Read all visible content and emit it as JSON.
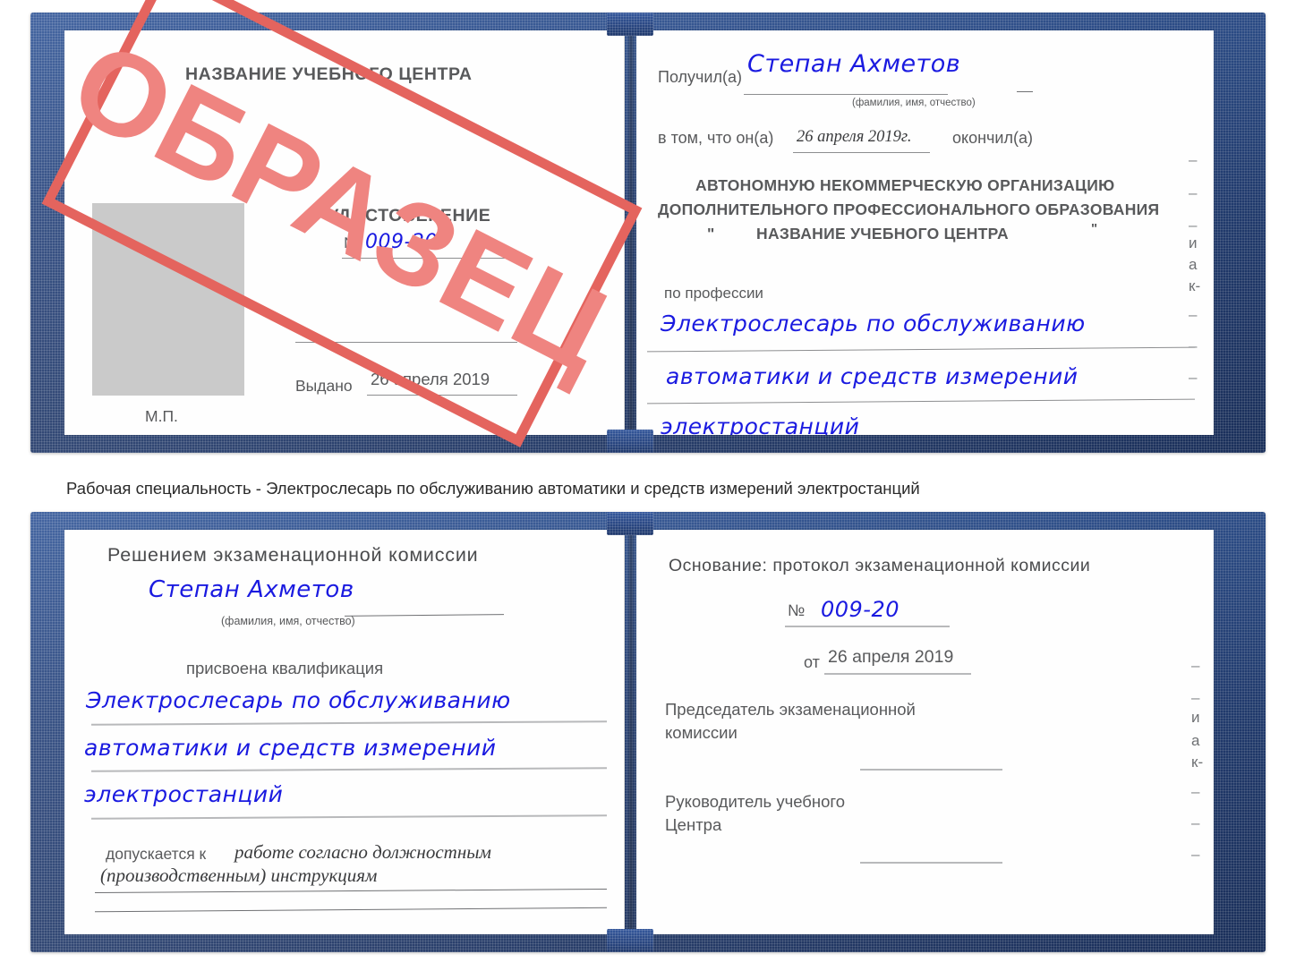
{
  "document": {
    "type": "Удостоверение (certificate booklet) — sample scan",
    "watermark": "ОБРАЗЕЦ",
    "ink_color": "#1a1ae0",
    "cover_color": "#234079",
    "stamp_color": "#e4645e"
  },
  "top_certificate": {
    "left_page": {
      "center_name": "НАЗВАНИЕ УЧЕБНОГО ЦЕНТРА",
      "title": "УДОСТОВЕРЕНИЕ",
      "number_label": "№",
      "number_value": "009-20",
      "issued_label": "Выдано",
      "issued_value": "26 апреля 2019",
      "seal_label": "М.П.",
      "photo_placeholder": "photo-area"
    },
    "right_page": {
      "received_label": "Получил(а)",
      "received_value": "Степан Ахметов",
      "received_hint": "(фамилия, имя, отчество)",
      "that_he_label": "в том, что он(а)",
      "completion_date": "26 апреля 2019г.",
      "finished_label": "окончил(а)",
      "org_line1": "АВТОНОМНУЮ НЕКОММЕРЧЕСКУЮ ОРГАНИЗАЦИЮ",
      "org_line2": "ДОПОЛНИТЕЛЬНОГО ПРОФЕССИОНАЛЬНОГО ОБРАЗОВАНИЯ",
      "org_quote_open": "\"",
      "org_line3": "НАЗВАНИЕ УЧЕБНОГО ЦЕНТРА",
      "org_quote_close": "\"",
      "profession_label": "по профессии",
      "profession_line1": "Электрослесарь по обслуживанию",
      "profession_line2": "автоматики и средств измерений",
      "profession_line3": "электростанций",
      "edge_bleed": [
        "–",
        "–",
        "–",
        "и",
        "а",
        "к-",
        "–",
        "–",
        "–"
      ]
    }
  },
  "caption": {
    "text": "Рабочая специальность - Электрослесарь по обслуживанию автоматики и средств измерений электростанций"
  },
  "bottom_certificate": {
    "left_page": {
      "heading": "Решением экзаменационной комиссии",
      "name_value": "Степан Ахметов",
      "name_hint": "(фамилия, имя, отчество)",
      "qualification_label": "присвоена квалификация",
      "qualification_line1": "Электрослесарь по обслуживанию",
      "qualification_line2": "автоматики и средств измерений",
      "qualification_line3": "электростанций",
      "admitted_label": "допускается к",
      "admitted_line1": "работе согласно должностным",
      "admitted_line2": "(производственным) инструкциям"
    },
    "right_page": {
      "basis_label": "Основание: протокол экзаменационной комиссии",
      "number_label": "№",
      "number_value": "009-20",
      "date_label": "от",
      "date_value": "26 апреля 2019",
      "chair_line1": "Председатель экзаменационной",
      "chair_line2": "комиссии",
      "head_line1": "Руководитель учебного",
      "head_line2": "Центра",
      "edge_bleed": [
        "–",
        "–",
        "и",
        "а",
        "к-",
        "–",
        "–",
        "–"
      ]
    }
  }
}
